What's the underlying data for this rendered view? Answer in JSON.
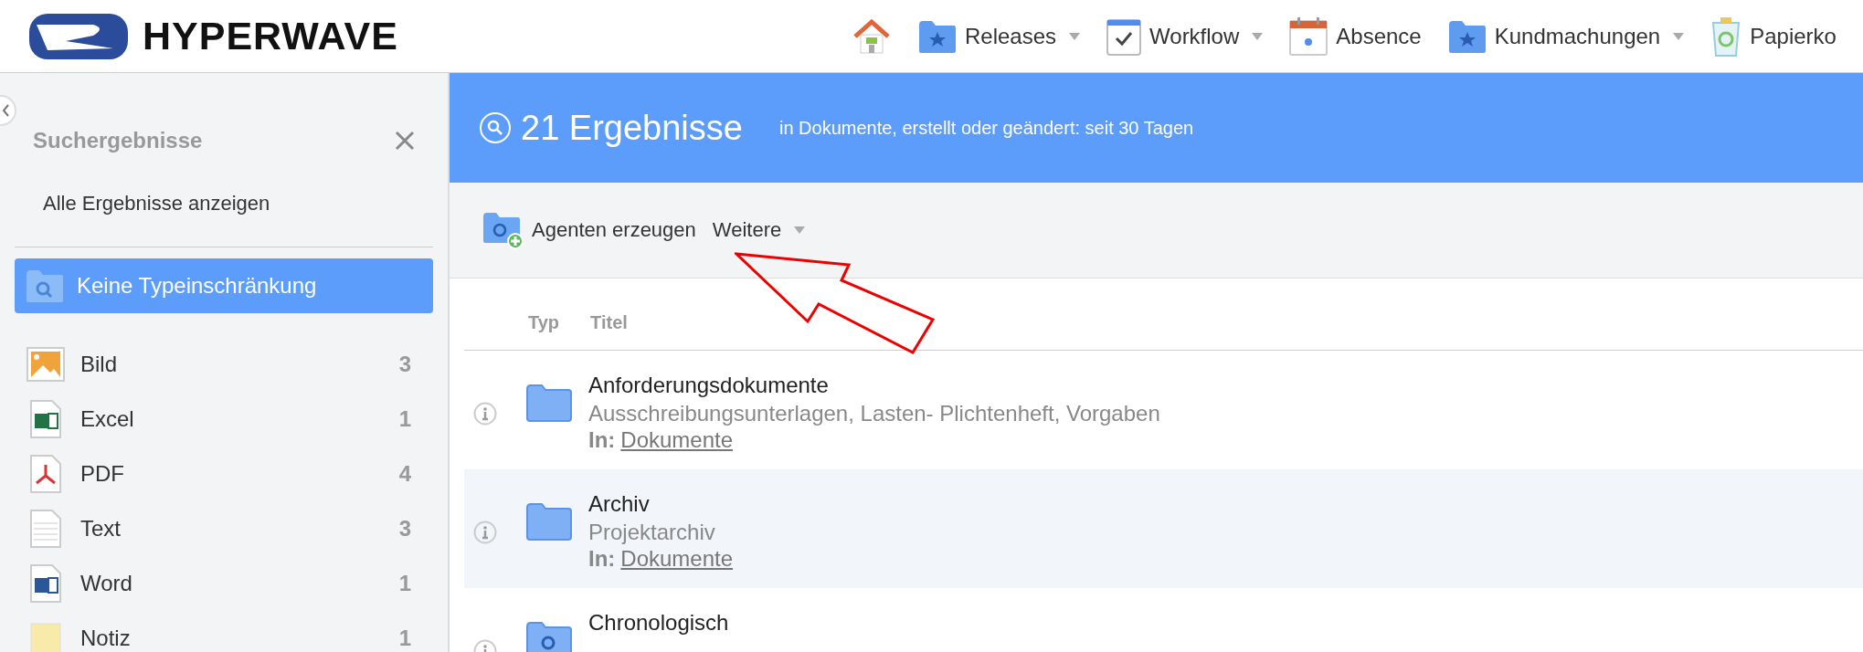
{
  "logo": {
    "text": "HYPERWAVE"
  },
  "nav": [
    {
      "kind": "home"
    },
    {
      "kind": "folder",
      "label": "Releases",
      "has_menu": true
    },
    {
      "kind": "checklist",
      "label": "Workflow",
      "has_menu": true
    },
    {
      "kind": "calendar",
      "label": "Absence",
      "has_menu": false
    },
    {
      "kind": "folder",
      "label": "Kundmachungen",
      "has_menu": true
    },
    {
      "kind": "trash",
      "label": "Papierko",
      "has_menu": false
    }
  ],
  "sidebar": {
    "title": "Suchergebnisse",
    "show_all": "Alle Ergebnisse anzeigen",
    "filter": {
      "label": "Keine Typeinschränkung",
      "selected": true
    },
    "types": [
      {
        "kind": "image",
        "label": "Bild",
        "count": "3"
      },
      {
        "kind": "excel",
        "label": "Excel",
        "count": "1"
      },
      {
        "kind": "pdf",
        "label": "PDF",
        "count": "4"
      },
      {
        "kind": "text",
        "label": "Text",
        "count": "3"
      },
      {
        "kind": "word",
        "label": "Word",
        "count": "1"
      },
      {
        "kind": "note",
        "label": "Notiz",
        "count": "1"
      }
    ]
  },
  "header": {
    "count": "21 Ergebnisse",
    "scope": "in Dokumente, erstellt oder geändert: seit 30 Tagen"
  },
  "toolbar": {
    "create_agent": "Agenten erzeugen",
    "more": "Weitere"
  },
  "table": {
    "columns": [
      "Typ",
      "Titel"
    ],
    "rows": [
      {
        "kind": "folder",
        "title": "Anforderungsdokumente",
        "description": "Ausschreibungsunterlagen, Lasten- Plichtenheft, Vorgaben",
        "location_label": "In:",
        "location": "Dokumente",
        "selected": false
      },
      {
        "kind": "folder",
        "title": "Archiv",
        "description": "Projektarchiv",
        "location_label": "In:",
        "location": "Dokumente",
        "selected": true
      },
      {
        "kind": "search-folder",
        "title": "Chronologisch",
        "selected": false
      }
    ]
  }
}
